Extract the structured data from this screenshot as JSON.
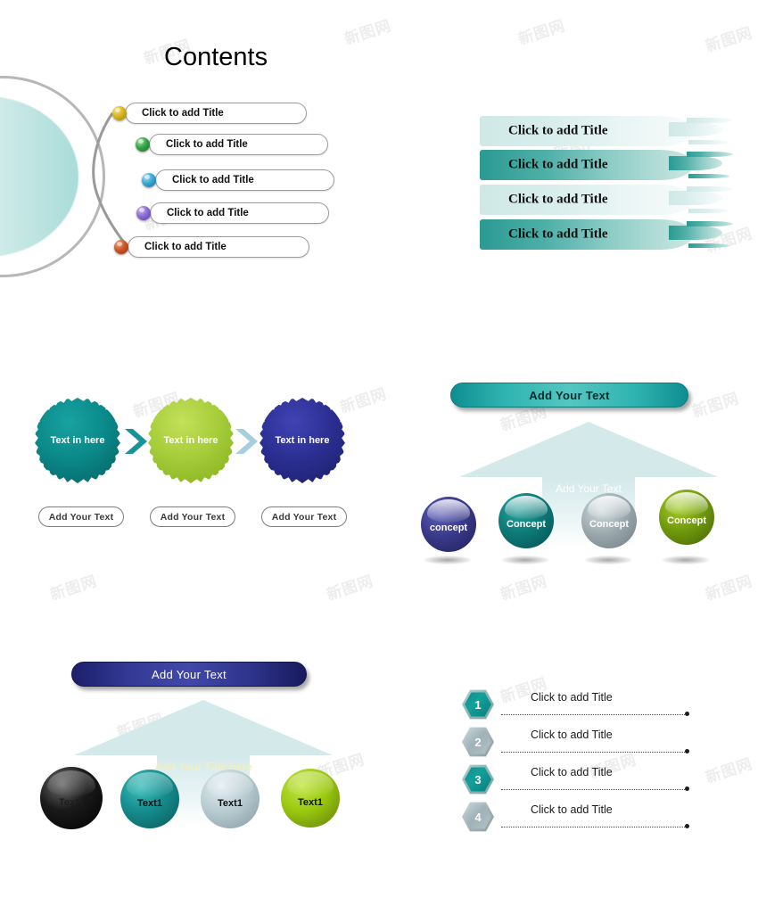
{
  "page": {
    "title": "Contents",
    "watermark_text": "新图网"
  },
  "contents_section": {
    "items": [
      {
        "label": "Click to add Title",
        "bullet_color": "#d9b51c",
        "bullet_color_dark": "#9c7d04"
      },
      {
        "label": "Click to add Title",
        "bullet_color": "#36a446",
        "bullet_color_dark": "#14702a"
      },
      {
        "label": "Click to add Title",
        "bullet_color": "#3aa8d6",
        "bullet_color_dark": "#1b6f99"
      },
      {
        "label": "Click to add Title",
        "bullet_color": "#8b6bd6",
        "bullet_color_dark": "#5b3ba3"
      },
      {
        "label": "Click to add Title",
        "bullet_color": "#cc5528",
        "bullet_color_dark": "#8d3511"
      }
    ]
  },
  "brush_section": {
    "items": [
      {
        "label": "Click to add Title",
        "style": "light"
      },
      {
        "label": "Click to add Title",
        "style": "dark"
      },
      {
        "label": "Click to add Title",
        "style": "light"
      },
      {
        "label": "Click to add Title",
        "style": "dark"
      }
    ]
  },
  "splatter_section": {
    "nodes": [
      {
        "label": "Text in here",
        "color": "#0b8a8a",
        "button": "Add Your Text"
      },
      {
        "label": "Text in here",
        "color": "#a6cd3a",
        "button": "Add Your Text"
      },
      {
        "label": "Text in here",
        "color": "#2c2f93",
        "button": "Add Your Text"
      }
    ],
    "arrow_colors": [
      "#17939a",
      "#a6cede"
    ]
  },
  "arrow_teal_section": {
    "banner_label": "Add Your Text",
    "arrow_label": "Add Your Text",
    "spheres": [
      {
        "label": "concept",
        "color": "#3a3a8c",
        "text_color": "#ffffff"
      },
      {
        "label": "Concept",
        "color": "#0e7a78",
        "text_color": "#ffffff"
      },
      {
        "label": "Concept",
        "color": "#9aa8ad",
        "text_color": "#ffffff"
      },
      {
        "label": "Concept",
        "color": "#739c0c",
        "text_color": "#ffffff"
      }
    ]
  },
  "arrow_navy_section": {
    "banner_label": "Add Your Text",
    "arrow_label": "Add Your Title here",
    "spheres": [
      {
        "label": "Text1",
        "color": "#0d0d0d",
        "text_color": "#1d1d1d"
      },
      {
        "label": "Text1",
        "color": "#168f90",
        "text_color": "#101010"
      },
      {
        "label": "Text1",
        "color": "#b8ccd2",
        "text_color": "#101010"
      },
      {
        "label": "Text1",
        "color": "#9bc90f",
        "text_color": "#101010"
      }
    ]
  },
  "hexagon_section": {
    "rows": [
      {
        "number": "1",
        "label": "Click to add Title",
        "style": "teal"
      },
      {
        "number": "2",
        "label": "Click to add Title",
        "style": "gray"
      },
      {
        "number": "3",
        "label": "Click to add Title",
        "style": "teal"
      },
      {
        "number": "4",
        "label": "Click to add Title",
        "style": "gray"
      }
    ]
  }
}
